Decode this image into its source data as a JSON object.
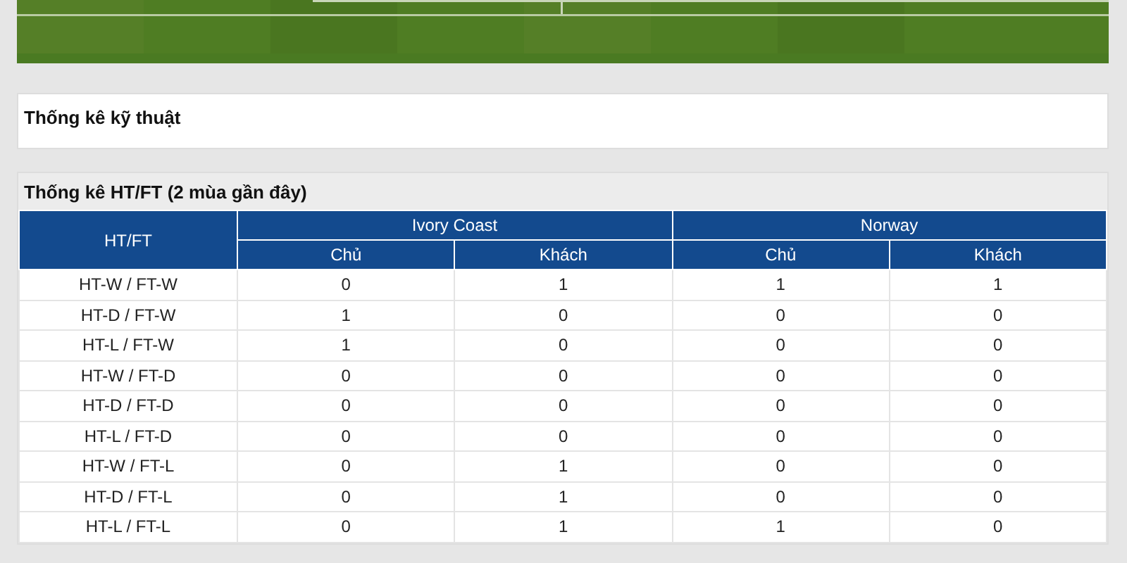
{
  "technical_stats": {
    "title": "Thống kê kỹ thuật"
  },
  "htft_table": {
    "title": "Thống kê HT/FT (2 mùa gần đây)",
    "first_column": "HT/FT",
    "teams": [
      {
        "name": "Ivory Coast",
        "columns": [
          "Chủ",
          "Khách"
        ]
      },
      {
        "name": "Norway",
        "columns": [
          "Chủ",
          "Khách"
        ]
      }
    ],
    "rows": [
      {
        "label": "HT-W / FT-W",
        "cells": [
          "0",
          "1",
          "1",
          "1"
        ]
      },
      {
        "label": "HT-D / FT-W",
        "cells": [
          "1",
          "0",
          "0",
          "0"
        ]
      },
      {
        "label": "HT-L / FT-W",
        "cells": [
          "1",
          "0",
          "0",
          "0"
        ]
      },
      {
        "label": "HT-W / FT-D",
        "cells": [
          "0",
          "0",
          "0",
          "0"
        ]
      },
      {
        "label": "HT-D / FT-D",
        "cells": [
          "0",
          "0",
          "0",
          "0"
        ]
      },
      {
        "label": "HT-L / FT-D",
        "cells": [
          "0",
          "0",
          "0",
          "0"
        ]
      },
      {
        "label": "HT-W / FT-L",
        "cells": [
          "0",
          "1",
          "0",
          "0"
        ]
      },
      {
        "label": "HT-D / FT-L",
        "cells": [
          "0",
          "1",
          "0",
          "0"
        ]
      },
      {
        "label": "HT-L / FT-L",
        "cells": [
          "0",
          "1",
          "1",
          "0"
        ]
      }
    ]
  }
}
